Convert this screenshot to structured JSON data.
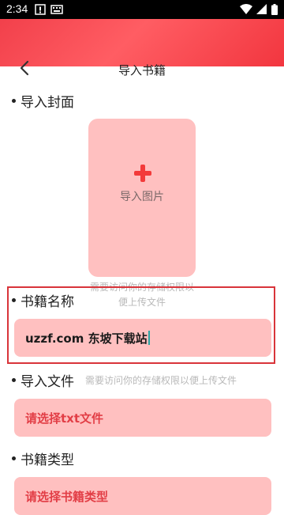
{
  "status_bar": {
    "time": "2:34"
  },
  "header": {
    "title": "导入书籍"
  },
  "cover": {
    "title": "导入封面",
    "button_label": "导入图片",
    "hint": "需要访问你的存储权限以便上传文件"
  },
  "book_name": {
    "title": "书籍名称",
    "value": "uzzf.com 东坡下载站"
  },
  "import_file": {
    "title": "导入文件",
    "hint": "需要访问你的存储权限以便上传文件",
    "placeholder": "请选择txt文件"
  },
  "book_type": {
    "title": "书籍类型",
    "placeholder": "请选择书籍类型"
  },
  "colors": {
    "accent": "#f33a3a",
    "field_bg": "#ffc0c0",
    "highlight": "#d9343a"
  }
}
